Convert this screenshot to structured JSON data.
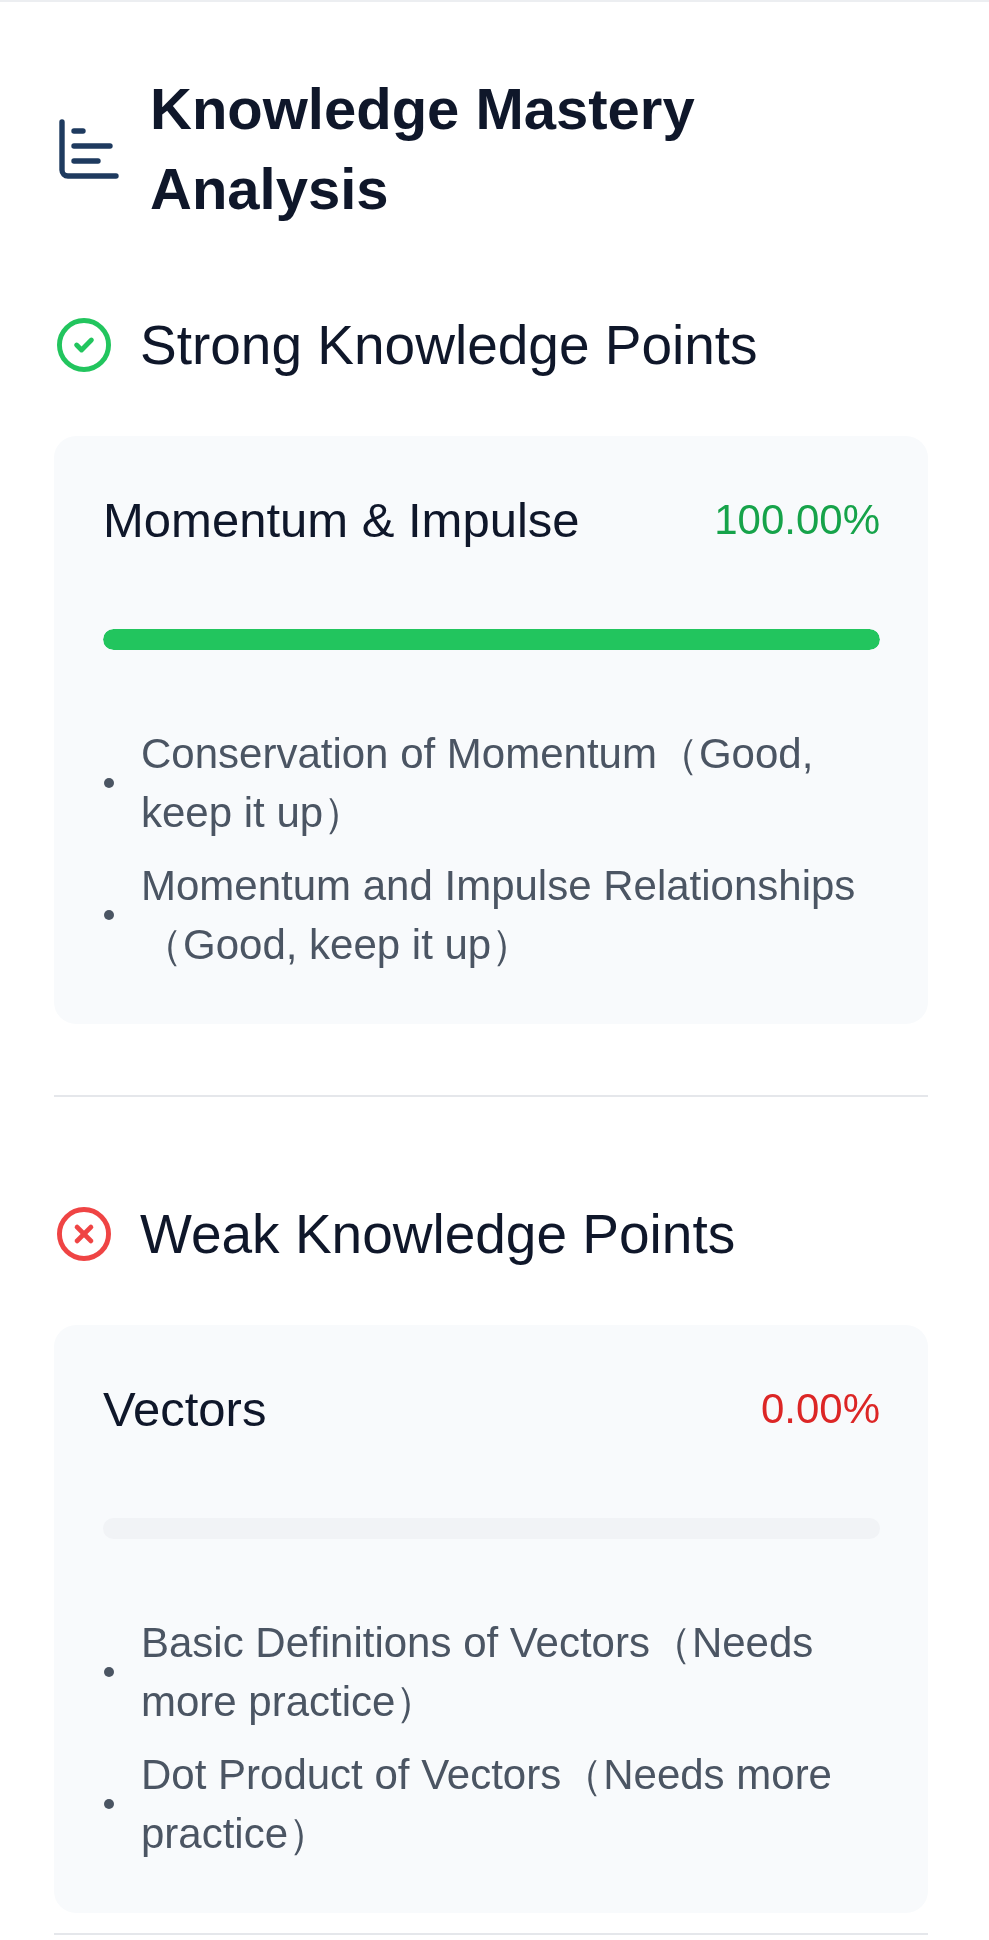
{
  "header": {
    "title": "Knowledge Mastery Analysis"
  },
  "sections": [
    {
      "kind": "strong",
      "heading": "Strong Knowledge Points",
      "topics": [
        {
          "name": "Momentum & Impulse",
          "percent": "100.00%",
          "level": 1,
          "points": [
            "Conservation of Momentum（Good, keep it up）",
            "Momentum and Impulse Relationships（Good, keep it up）"
          ]
        }
      ]
    },
    {
      "kind": "weak",
      "heading": "Weak Knowledge Points",
      "topics": [
        {
          "name": "Vectors",
          "percent": "0.00%",
          "level": 0,
          "points": [
            "Basic Definitions of Vectors（Needs more practice）",
            "Dot Product of Vectors（Needs more practice）"
          ]
        }
      ]
    }
  ]
}
